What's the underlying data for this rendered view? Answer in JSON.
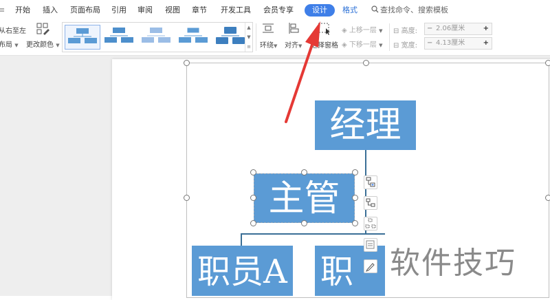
{
  "menubar": {
    "tabs": [
      "开始",
      "插入",
      "页面布局",
      "引用",
      "审阅",
      "视图",
      "章节",
      "开发工具",
      "会员专享"
    ],
    "active_tab": "设计",
    "format_tab": "格式",
    "search_text": "查找命令、搜索模板",
    "left_fragment": "≡"
  },
  "toolbar": {
    "left_top": "从右至左",
    "left_bottom": "布局",
    "change_color": "更改颜色",
    "wrap": "环绕",
    "align": "对齐",
    "select_pane": "选择窗格",
    "move_up": "上移一层",
    "move_down": "下移一层",
    "height_label": "高度:",
    "height_value": "2.06厘米",
    "width_label": "宽度:",
    "width_value": "4.13厘米"
  },
  "diagram": {
    "manager": "经理",
    "supervisor": "主管",
    "staff_a": "职员A",
    "staff_b": "职员"
  },
  "watermark": "软件技巧",
  "colors": {
    "accent": "#3f7fe8",
    "node": "#5b9bd5",
    "arrow": "#e53935"
  }
}
